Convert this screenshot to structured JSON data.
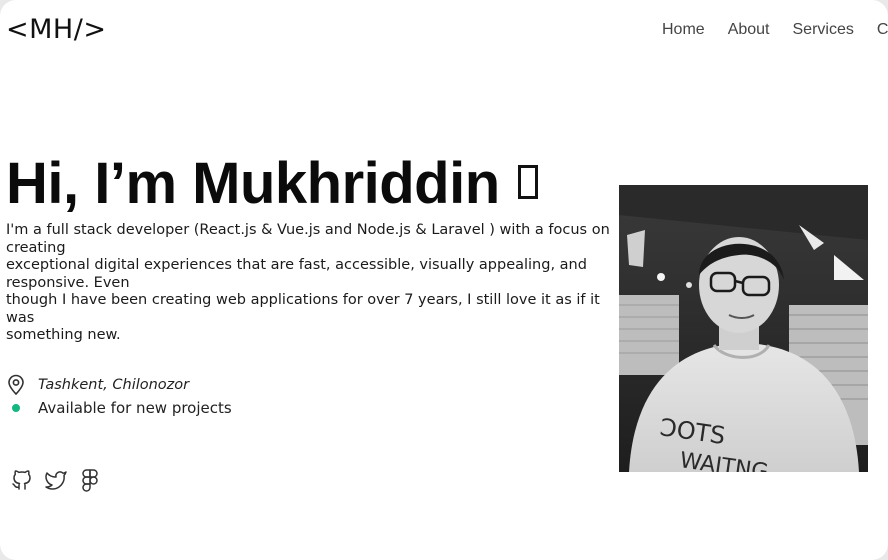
{
  "header": {
    "logo": "<MH/>",
    "nav": [
      "Home",
      "About",
      "Services",
      "Co"
    ]
  },
  "hero": {
    "title": "Hi, I’m Mukhriddin",
    "bio_lines": [
      "I'm a full stack developer (React.js & Vue.js and Node.js & Laravel ) with a focus on",
      "creating",
      "exceptional digital experiences that are fast, accessible, visually appealing, and",
      "responsive. Even",
      "though I have been creating web applications for over 7 years, I still love it as if it was",
      "something new."
    ],
    "location": "Tashkent, Chilonozor",
    "availability": "Available for new projects",
    "socials": [
      "github-icon",
      "twitter-icon",
      "figma-icon"
    ],
    "status_color": "#10b981"
  }
}
